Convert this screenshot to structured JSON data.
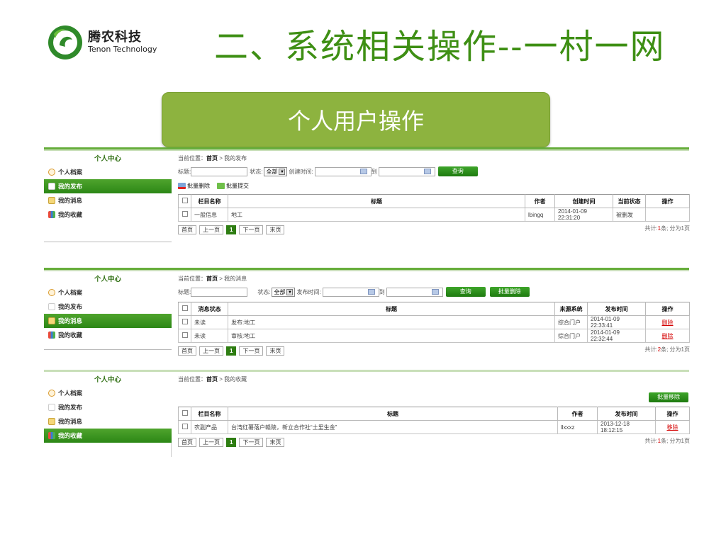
{
  "header": {
    "logo_cn": "腾农科技",
    "logo_en": "Tenon Technology",
    "slide_title": "二、系统相关操作--一村一网",
    "banner": "个人用户操作"
  },
  "colors": {
    "brand_green": "#3e8f14",
    "banner_green": "#8db33f",
    "active_green": "#2c8716",
    "delete_red": "#d40000"
  },
  "sidebar": {
    "title": "个人中心",
    "items": [
      {
        "label": "个人档案",
        "icon": "user-icon"
      },
      {
        "label": "我的发布",
        "icon": "document-icon"
      },
      {
        "label": "我的消息",
        "icon": "message-icon"
      },
      {
        "label": "我的收藏",
        "icon": "favorites-icon"
      }
    ]
  },
  "panel1": {
    "crumb_prefix": "当前位置：",
    "crumb_home": "首页",
    "crumb_page": "> 我的发布",
    "title_label": "标题:",
    "status_label": "状态:",
    "status_value": "全部",
    "time_label": "创建时间:",
    "to_label": "到",
    "query_btn": "查询",
    "batch_delete": "批量删除",
    "batch_submit": "批量提交",
    "columns": [
      "栏目名称",
      "标题",
      "作者",
      "创建时间",
      "当前状态",
      "操作"
    ],
    "rows": [
      {
        "col": "一般信息",
        "title": "地工",
        "author": "lbingq",
        "time": "2014-01-09 22:31:20",
        "status": "被删发",
        "op": ""
      }
    ],
    "pager": [
      "首页",
      "上一页",
      "1",
      "下一页",
      "末页"
    ],
    "total_a": "共计:",
    "total_n": "1",
    "total_b": "条; 分为1页"
  },
  "panel2": {
    "crumb_prefix": "当前位置：",
    "crumb_home": "首页",
    "crumb_page": "> 我的消息",
    "title_label": "标题:",
    "status_label": "状态:",
    "status_value": "全部",
    "time_label": "发布时间:",
    "to_label": "到",
    "query_btn": "查询",
    "batch_delete": "批量删除",
    "columns": [
      "消息状态",
      "标题",
      "来源系统",
      "发布时间",
      "操作"
    ],
    "rows": [
      {
        "state": "未读",
        "title": "发布:地工",
        "source": "综合门户",
        "time": "2014-01-09 22:33:41",
        "op": "删除"
      },
      {
        "state": "未读",
        "title": "审核:地工",
        "source": "综合门户",
        "time": "2014-01-09 22:32:44",
        "op": "删除"
      }
    ],
    "pager": [
      "首页",
      "上一页",
      "1",
      "下一页",
      "末页"
    ],
    "total_a": "共计:",
    "total_n": "2",
    "total_b": "条; 分为1页"
  },
  "panel3": {
    "crumb_prefix": "当前位置：",
    "crumb_home": "首页",
    "crumb_page": "> 我的收藏",
    "batch_remove": "批量移除",
    "columns": [
      "栏目名称",
      "标题",
      "作者",
      "发布时间",
      "操作"
    ],
    "rows": [
      {
        "col": "农副产品",
        "title": "台湾红薯落户赣陵，新立合作社“土里生金”",
        "author": "llxxxz",
        "time": "2013-12-18 18:12:15",
        "op": "移除"
      }
    ],
    "pager": [
      "首页",
      "上一页",
      "1",
      "下一页",
      "末页"
    ],
    "total_a": "共计:",
    "total_n": "1",
    "total_b": "条; 分为1页"
  }
}
